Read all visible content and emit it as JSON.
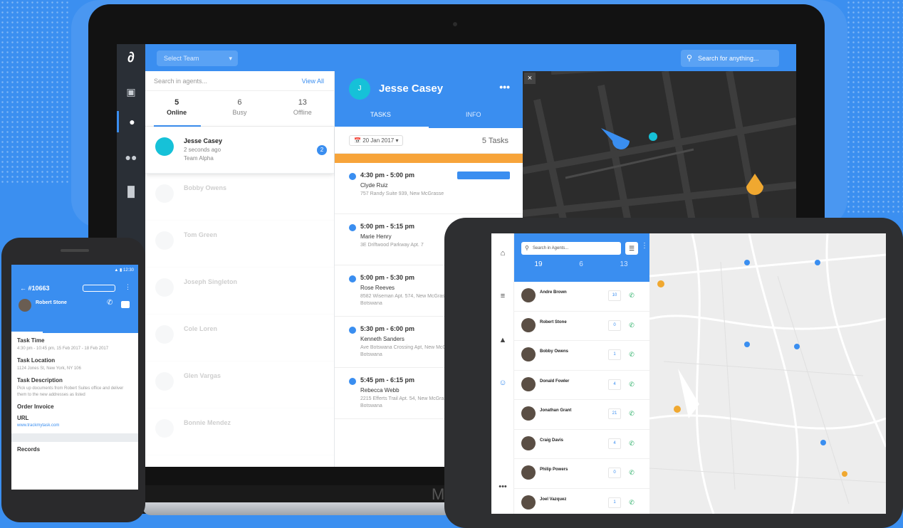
{
  "laptop": {
    "brand": "M",
    "logo_glyph": "∂",
    "topbar": {
      "team_select": "Select Team",
      "search": "Search for anything..."
    },
    "agents": {
      "search_placeholder": "Search in agents...",
      "view_all": "View All",
      "counts": [
        {
          "n": "5",
          "label": "Online"
        },
        {
          "n": "6",
          "label": "Busy"
        },
        {
          "n": "13",
          "label": "Offline"
        }
      ],
      "rows": [
        {
          "name": "Jesse Casey",
          "line1": "2 seconds ago",
          "line2": "Team Alpha",
          "badge": "2"
        },
        {
          "name": "Bobby Owens",
          "line1": "",
          "line2": ""
        },
        {
          "name": "Tom Green",
          "line1": "",
          "line2": ""
        },
        {
          "name": "Joseph Singleton",
          "line1": "",
          "line2": ""
        },
        {
          "name": "Cole Loren",
          "line1": "",
          "line2": ""
        },
        {
          "name": "Glen Vargas",
          "line1": "",
          "line2": ""
        },
        {
          "name": "Bonnie Mendez",
          "line1": "",
          "line2": ""
        }
      ]
    },
    "detail": {
      "avatar_initial": "J",
      "name": "Jesse Casey",
      "more": "•••",
      "tabs": [
        "TASKS",
        "INFO"
      ],
      "date": "20 Jan 2017",
      "task_count": "5 Tasks",
      "tasks": [
        {
          "time": "4:30 pm - 5:00 pm",
          "name": "Clyde Ruiz",
          "address": "757 Randy Suite 939, New McGrasse"
        },
        {
          "time": "5:00 pm - 5:15 pm",
          "name": "Marie Henry",
          "address": "3E Driftwood Parkway Apt. 7"
        },
        {
          "time": "5:00 pm - 5:30 pm",
          "name": "Rose Reeves",
          "address": "8582 Wiseman Apt. 574, New McGrasse, Botswana"
        },
        {
          "time": "5:30 pm - 6:00 pm",
          "name": "Kenneth Sanders",
          "address": "Ave Botswana Crossing Apt, New McGrasse, Botswana"
        },
        {
          "time": "5:45 pm - 6:15 pm",
          "name": "Rebecca Webb",
          "address": "2215 Efferts Trail Apt. 54, New McGrasse, Botswana"
        }
      ]
    },
    "map": {
      "close": "×"
    }
  },
  "phone": {
    "task_id": "#10663",
    "name": "Robert Stone",
    "more": "⋮",
    "sections": [
      {
        "label": "Task Time",
        "value": "4:30 pm - 10:45 pm, 15 Feb 2017 - 18 Feb 2017"
      },
      {
        "label": "Task Location",
        "value": "1124 Jones St, New York, NY 106"
      },
      {
        "label": "Task Description",
        "value": "Pick up documents from Robert Suites office and deliver them to the new addresses as listed"
      }
    ],
    "invoice_label": "Order Invoice",
    "url_label": "URL",
    "url_value": "www.trackmytask.com",
    "records_label": "Records"
  },
  "tablet": {
    "search_placeholder": "Search in Agents...",
    "counts": [
      {
        "n": "19"
      },
      {
        "n": "6"
      },
      {
        "n": "13"
      }
    ],
    "rail": [
      "⌂",
      "≡",
      "☺",
      "•••"
    ],
    "agents": [
      {
        "name": "Andre Brown",
        "count": "10"
      },
      {
        "name": "Robert Stone",
        "count": "0"
      },
      {
        "name": "Bobby Owens",
        "count": "1"
      },
      {
        "name": "Donald Fowler",
        "count": "4"
      },
      {
        "name": "Jonathan Grant",
        "count": "21"
      },
      {
        "name": "Craig Davis",
        "count": "4"
      },
      {
        "name": "Philip Powers",
        "count": "0"
      },
      {
        "name": "Joel Vazquez",
        "count": "1"
      }
    ]
  },
  "colors": {
    "primary": "#3a8ef0",
    "orange": "#f7a43a",
    "teal": "#16c1d8",
    "call_green": "#2fb16b",
    "dark": "#2a2f36"
  }
}
